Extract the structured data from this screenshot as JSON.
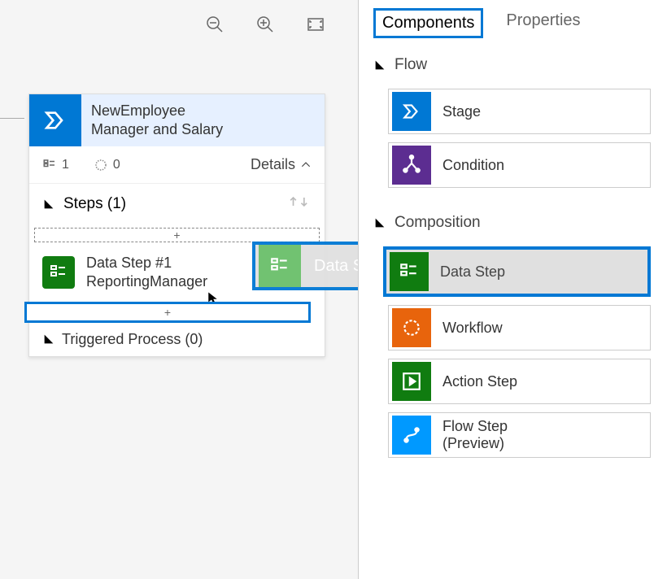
{
  "tabs": {
    "components_label": "Components",
    "properties_label": "Properties"
  },
  "stage": {
    "title_line1": "NewEmployee",
    "title_line2": "Manager and Salary",
    "stat1": "1",
    "stat2": "0",
    "details_label": "Details"
  },
  "steps": {
    "header": "Steps (1)",
    "step1_line1": "Data Step #1",
    "step1_line2": "ReportingManager",
    "add_symbol": "+",
    "triggered": "Triggered Process (0)"
  },
  "drag": {
    "label": "Data Step"
  },
  "sections": {
    "flow": "Flow",
    "composition": "Composition"
  },
  "components": {
    "stage": "Stage",
    "condition": "Condition",
    "datastep": "Data Step",
    "workflow": "Workflow",
    "actionstep": "Action Step",
    "flowstep_l1": "Flow Step",
    "flowstep_l2": "(Preview)"
  }
}
